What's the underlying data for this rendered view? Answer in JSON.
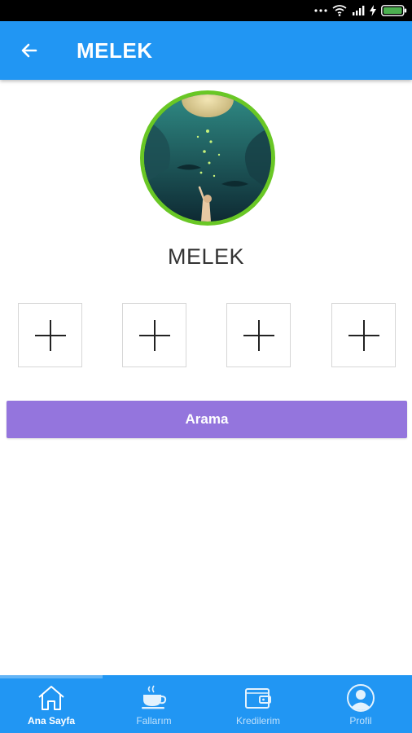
{
  "app_bar": {
    "title": "MELEK",
    "back_icon": "arrow-left-icon"
  },
  "profile": {
    "name": "MELEK",
    "avatar_border_color": "#69c725"
  },
  "photo_slots": [
    {
      "icon": "plus-icon"
    },
    {
      "icon": "plus-icon"
    },
    {
      "icon": "plus-icon"
    },
    {
      "icon": "plus-icon"
    }
  ],
  "search_button": {
    "label": "Arama",
    "color": "#9475dd"
  },
  "bottom_nav": {
    "items": [
      {
        "label": "Ana Sayfa",
        "icon": "home-icon",
        "active": true
      },
      {
        "label": "Fallarım",
        "icon": "coffee-cup-icon",
        "active": false
      },
      {
        "label": "Kredilerim",
        "icon": "wallet-icon",
        "active": false
      },
      {
        "label": "Profil",
        "icon": "user-icon",
        "active": false
      }
    ]
  },
  "colors": {
    "primary": "#2196f3",
    "accent": "#9475dd",
    "status_bar": "#000000"
  }
}
